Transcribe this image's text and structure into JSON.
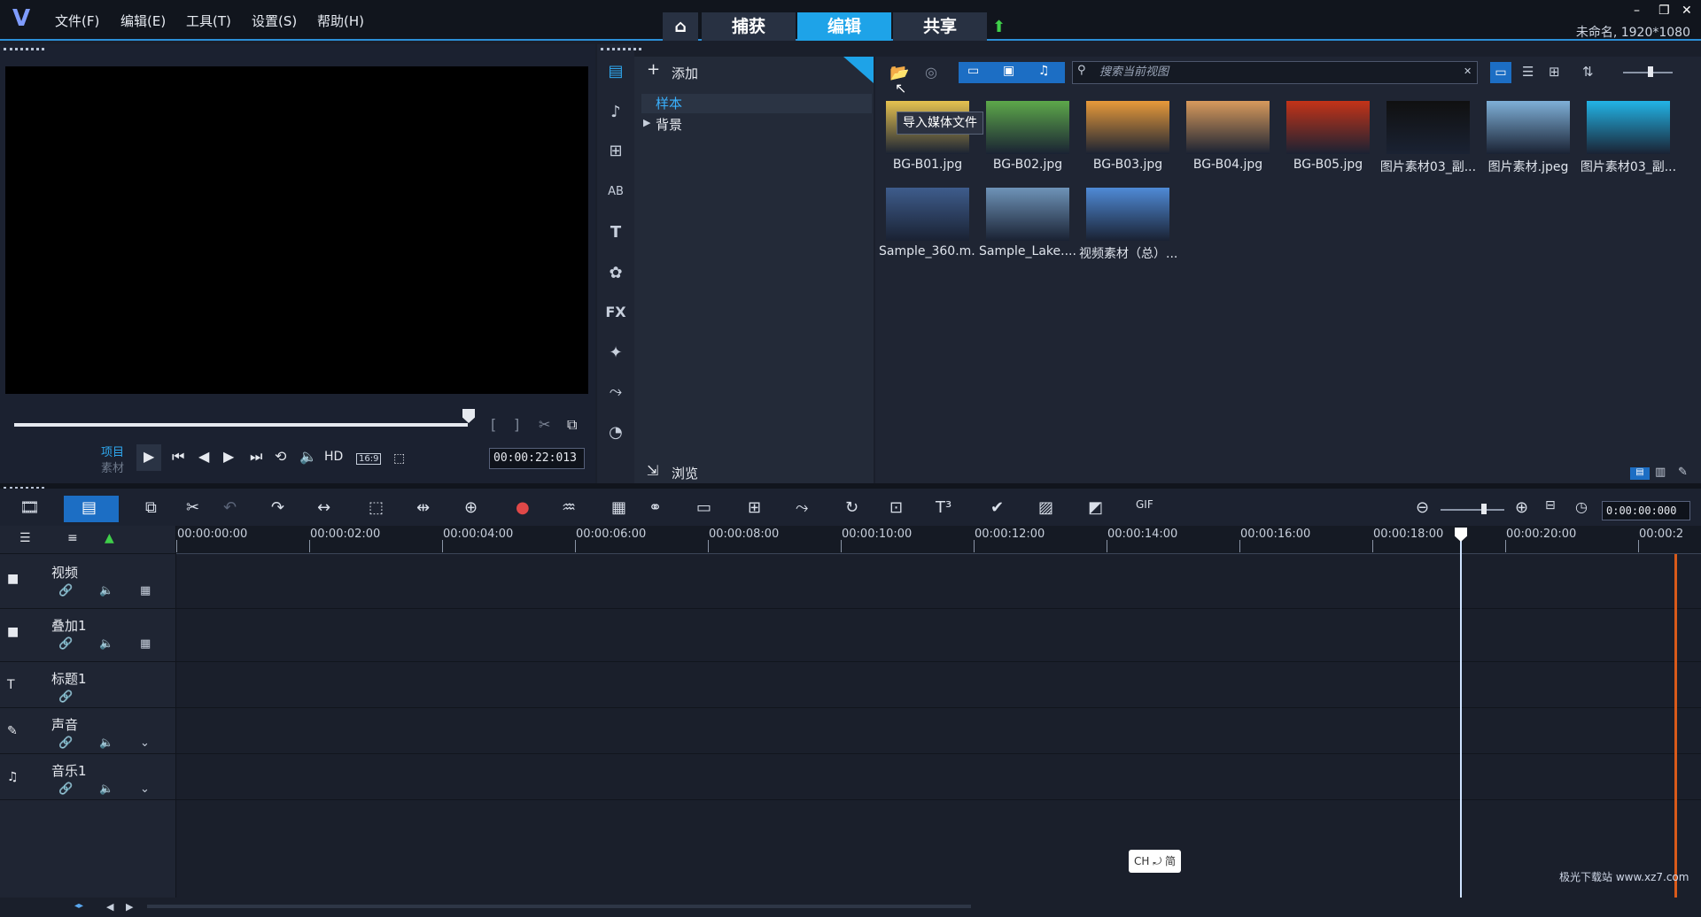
{
  "menu": [
    "文件(F)",
    "编辑(E)",
    "工具(T)",
    "设置(S)",
    "帮助(H)"
  ],
  "mode_tabs": [
    "捕获",
    "编辑",
    "共享"
  ],
  "window_title": "未命名, 1920*1080",
  "preview": {
    "project_label": "项目",
    "clip_label": "素材",
    "hd_label": "HD",
    "aspect_label": "16:9",
    "timecode": "00:00:22:013"
  },
  "library": {
    "add_label": "添加",
    "tree": [
      "样本",
      "背景"
    ],
    "browse_label": "浏览",
    "search_placeholder": "搜索当前视图",
    "tooltip": "导入媒体文件",
    "items": [
      {
        "caption": "BG-B01.jpg",
        "color": "#e6c250"
      },
      {
        "caption": "BG-B02.jpg",
        "color": "#5da84a"
      },
      {
        "caption": "BG-B03.jpg",
        "color": "#e89a3a"
      },
      {
        "caption": "BG-B04.jpg",
        "color": "#d89a5c"
      },
      {
        "caption": "BG-B05.jpg",
        "color": "#c43318"
      },
      {
        "caption": "图片素材03_副...",
        "color": "#101010"
      },
      {
        "caption": "图片素材.jpeg",
        "color": "#7fb0d8"
      },
      {
        "caption": "图片素材03_副...",
        "color": "#22b4e6"
      },
      {
        "caption": "Sample_360.m...",
        "color": "#3e5c8c"
      },
      {
        "caption": "Sample_Lake....",
        "color": "#6e93b8"
      },
      {
        "caption": "视频素材（总）...",
        "color": "#4f8ad6"
      }
    ]
  },
  "timeline": {
    "timecode": "0:00:00:000",
    "ruler": [
      "00:00:00:00",
      "00:00:02:00",
      "00:00:04:00",
      "00:00:06:00",
      "00:00:08:00",
      "00:00:10:00",
      "00:00:12:00",
      "00:00:14:00",
      "00:00:16:00",
      "00:00:18:00",
      "00:00:20:00",
      "00:00:2"
    ],
    "tracks": [
      "视频",
      "叠加1",
      "标题1",
      "声音",
      "音乐1"
    ]
  },
  "ime": "CH ⤾ 简",
  "watermark": "极光下载站 www.xz7.com"
}
